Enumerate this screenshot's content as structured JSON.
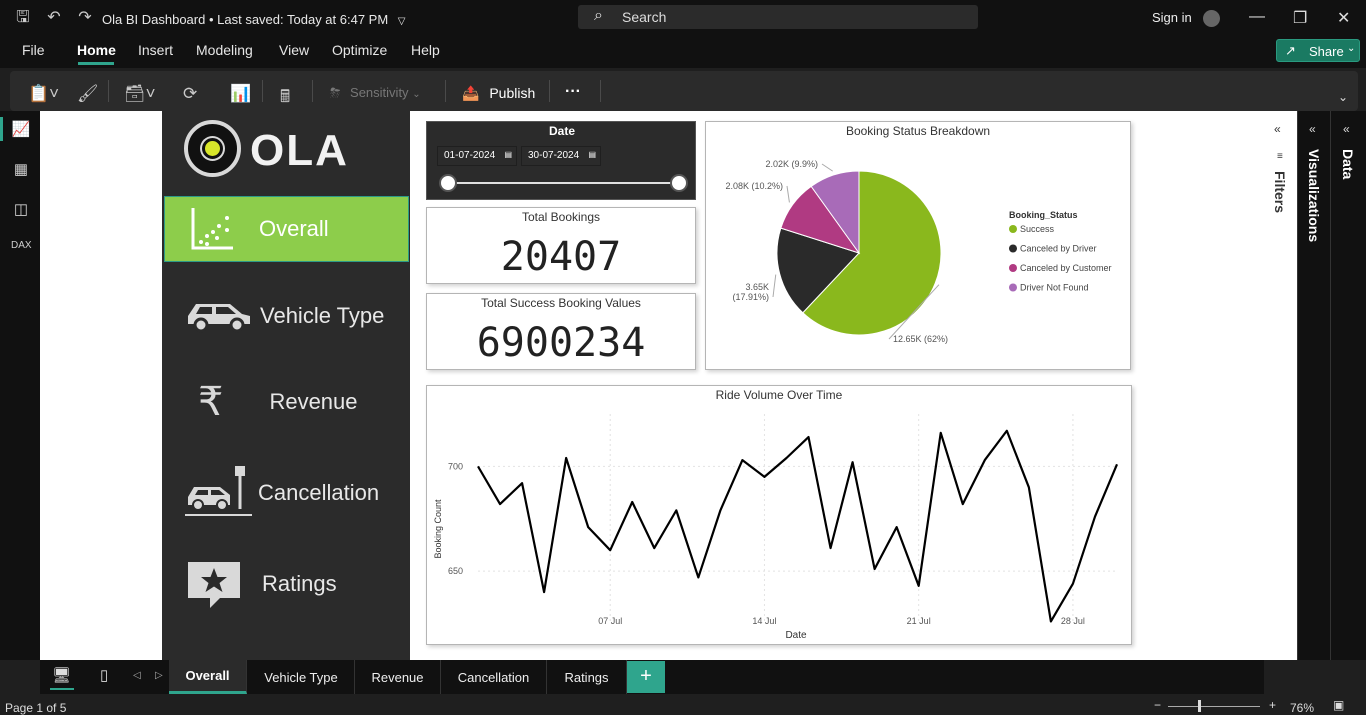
{
  "window": {
    "title": "Ola BI Dashboard",
    "saved_status": "Last saved: Today at 6:47 PM",
    "search_placeholder": "Search",
    "sign_in": "Sign in"
  },
  "menu": [
    "File",
    "Home",
    "Insert",
    "Modeling",
    "View",
    "Optimize",
    "Help"
  ],
  "share_label": "Share",
  "ribbon": {
    "sensitivity": "Sensitivity",
    "publish": "Publish",
    "more": "···"
  },
  "logo_text": "OLA",
  "sidebar": [
    {
      "label": "Overall",
      "icon": "scatter-chart-icon"
    },
    {
      "label": "Vehicle Type",
      "icon": "car-icon"
    },
    {
      "label": "Revenue",
      "icon": "rupee-icon"
    },
    {
      "label": "Cancellation",
      "icon": "car-parking-icon"
    },
    {
      "label": "Ratings",
      "icon": "star-bubble-icon"
    }
  ],
  "date_filter": {
    "title": "Date",
    "start": "01-07-2024",
    "end": "30-07-2024"
  },
  "kpis": [
    {
      "label": "Total Bookings",
      "value": "20407"
    },
    {
      "label": "Total Success Booking Values",
      "value": "6900234"
    }
  ],
  "panes": {
    "filters": "Filters",
    "visualizations": "Visualizations",
    "data": "Data"
  },
  "tabs": [
    "Overall",
    "Vehicle Type",
    "Revenue",
    "Cancellation",
    "Ratings"
  ],
  "status": {
    "page": "Page 1 of 5",
    "zoom": "76%"
  },
  "chart_data": [
    {
      "type": "pie",
      "title": "Booking Status Breakdown",
      "legend_title": "Booking_Status",
      "legend_position": "right",
      "slices": [
        {
          "name": "Success",
          "value": 12.65,
          "percent": 62,
          "label": "12.65K (62%)",
          "color": "#8ab81d"
        },
        {
          "name": "Canceled by Driver",
          "value": 3.65,
          "percent": 17.91,
          "label": "3.65K (17.91%)",
          "color": "#2a2a2a"
        },
        {
          "name": "Canceled by Customer",
          "value": 2.08,
          "percent": 10.2,
          "label": "2.08K (10.2%)",
          "color": "#b03a82"
        },
        {
          "name": "Driver Not Found",
          "value": 2.02,
          "percent": 9.9,
          "label": "2.02K (9.9%)",
          "color": "#a86bb8"
        }
      ]
    },
    {
      "type": "line",
      "title": "Ride Volume Over Time",
      "xlabel": "Date",
      "ylabel": "Booking Count",
      "x_ticks": [
        "07 Jul",
        "14 Jul",
        "21 Jul",
        "28 Jul"
      ],
      "y_ticks": [
        650,
        700
      ],
      "x": [
        "01 Jul",
        "02 Jul",
        "03 Jul",
        "04 Jul",
        "05 Jul",
        "06 Jul",
        "07 Jul",
        "08 Jul",
        "09 Jul",
        "10 Jul",
        "11 Jul",
        "12 Jul",
        "13 Jul",
        "14 Jul",
        "15 Jul",
        "16 Jul",
        "17 Jul",
        "18 Jul",
        "19 Jul",
        "20 Jul",
        "21 Jul",
        "22 Jul",
        "23 Jul",
        "24 Jul",
        "25 Jul",
        "26 Jul",
        "27 Jul",
        "28 Jul",
        "29 Jul",
        "30 Jul"
      ],
      "values": [
        700,
        682,
        692,
        640,
        704,
        671,
        660,
        683,
        661,
        679,
        647,
        679,
        703,
        695,
        704,
        714,
        661,
        702,
        651,
        671,
        643,
        716,
        682,
        703,
        717,
        690,
        626,
        644,
        676,
        701
      ],
      "ylim": [
        620,
        725
      ],
      "color": "#000000"
    }
  ]
}
